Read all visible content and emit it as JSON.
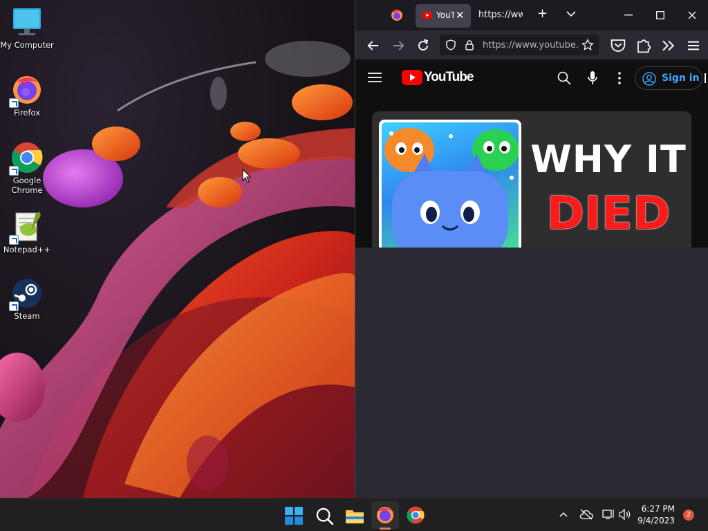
{
  "desktop": {
    "icons": [
      {
        "label": "My Computer",
        "icon": "monitor-icon"
      },
      {
        "label": "Firefox",
        "icon": "firefox-icon"
      },
      {
        "label": "Google Chrome",
        "icon": "chrome-icon"
      },
      {
        "label": "Notepad++",
        "icon": "notepadpp-icon"
      },
      {
        "label": "Steam",
        "icon": "steam-icon"
      }
    ]
  },
  "browser": {
    "tabs": [
      {
        "label": "YouTube",
        "icon": "youtube-favicon",
        "active": true
      },
      {
        "label": "https://www.",
        "active": false
      }
    ],
    "url": "https://www.youtube.com",
    "window_controls": [
      "minimize",
      "maximize",
      "close"
    ]
  },
  "youtube": {
    "logo_text": "YouTube",
    "sign_in": "Sign in",
    "thumbnail": {
      "line1": "WHY IT",
      "line2": "DIED"
    }
  },
  "taskbar": {
    "apps": [
      "windows-start-icon",
      "search-icon",
      "file-explorer-icon",
      "firefox-icon",
      "chrome-icon"
    ],
    "time": "6:27 PM",
    "date": "9/4/2023",
    "notifications": "2"
  },
  "colors": {
    "youtube_red": "#ff0000",
    "link_blue": "#3ea6ff",
    "taskbar_bg": "#202020",
    "browser_chrome": "#2b2a33"
  }
}
